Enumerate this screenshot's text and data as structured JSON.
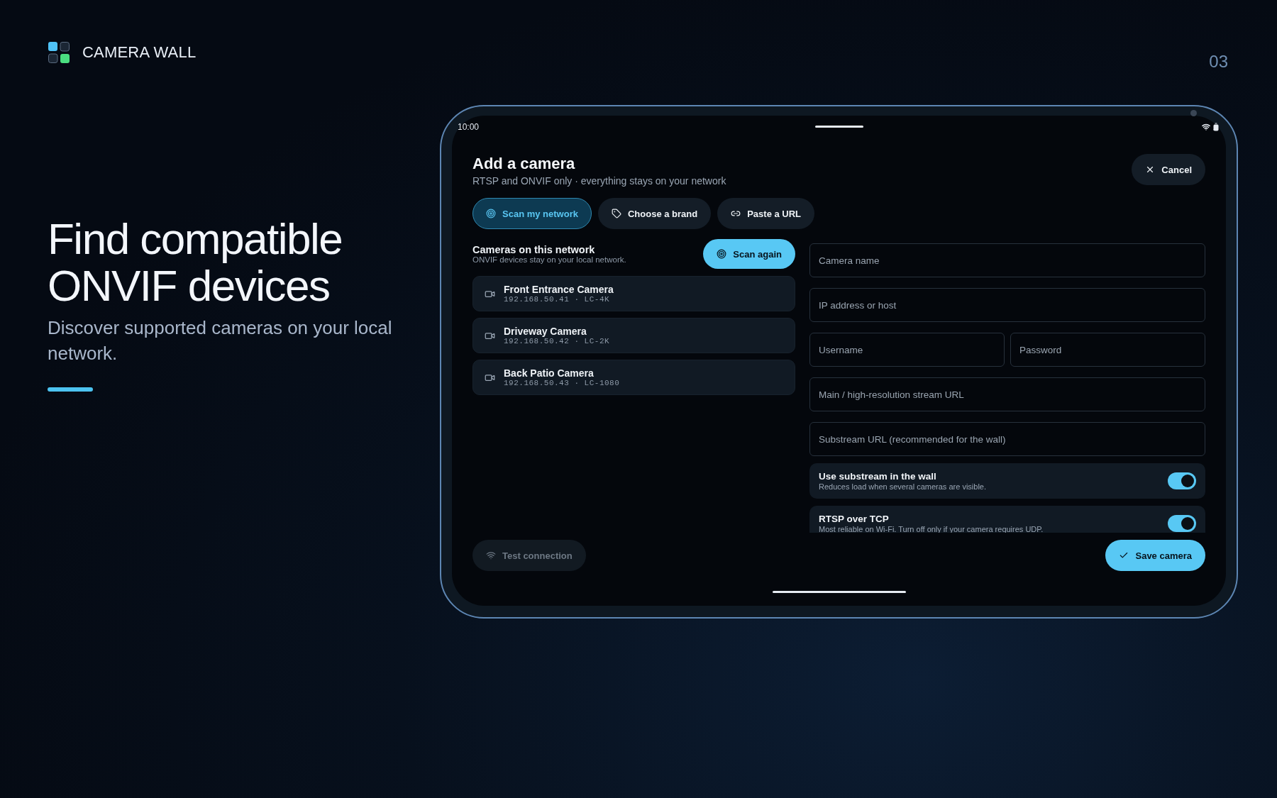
{
  "brand": {
    "name": "CAMERA WALL"
  },
  "page_number": "03",
  "hero": {
    "title": "Find compatible ONVIF devices",
    "subtitle": "Discover supported cameras on your local network."
  },
  "device": {
    "status_bar": {
      "time": "10:00"
    },
    "dialog": {
      "title": "Add a camera",
      "subtitle": "RTSP and ONVIF only · everything stays on your network",
      "cancel_button": "Cancel",
      "tabs": [
        {
          "label": "Scan my network",
          "kind": "scan",
          "selected": true
        },
        {
          "label": "Choose a brand",
          "kind": "brand",
          "selected": false
        },
        {
          "label": "Paste a URL",
          "kind": "url",
          "selected": false
        }
      ],
      "discovery": {
        "title": "Cameras on this network",
        "subtitle": "ONVIF devices stay on your local network.",
        "scan_button": "Scan again",
        "cameras": [
          {
            "name": "Front Entrance Camera",
            "detail": "192.168.50.41 · LC-4K"
          },
          {
            "name": "Driveway Camera",
            "detail": "192.168.50.42 · LC-2K"
          },
          {
            "name": "Back Patio Camera",
            "detail": "192.168.50.43 · LC-1080"
          }
        ]
      },
      "form": {
        "field_rows": [
          [
            {
              "placeholder": "Camera name"
            }
          ],
          [
            {
              "placeholder": "IP address or host"
            }
          ],
          [
            {
              "placeholder": "Username"
            },
            {
              "placeholder": "Password"
            }
          ],
          [
            {
              "placeholder": "Main / high-resolution stream URL"
            }
          ],
          [
            {
              "placeholder": "Substream URL (recommended for the wall)"
            }
          ]
        ],
        "toggles": [
          {
            "title": "Use substream in the wall",
            "description": "Reduces load when several cameras are visible.",
            "on": true
          },
          {
            "title": "RTSP over TCP",
            "description": "Most reliable on Wi-Fi. Turn off only if your camera requires UDP.",
            "on": true
          }
        ]
      },
      "test_button": {
        "label": "Test connection",
        "disabled": true
      },
      "save_button": "Save camera"
    }
  }
}
